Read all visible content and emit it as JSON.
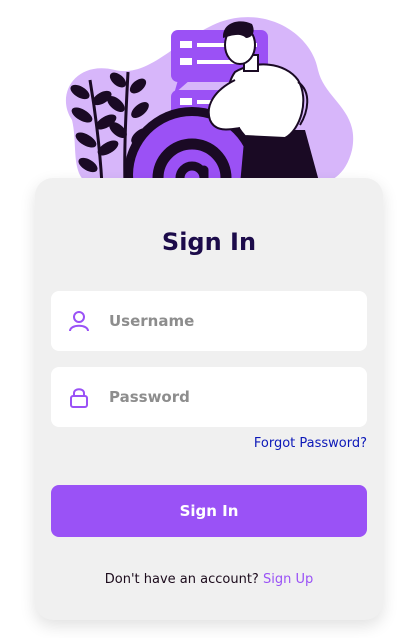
{
  "form": {
    "title": "Sign In",
    "username_placeholder": "Username",
    "password_placeholder": "Password",
    "forgot_label": "Forgot Password?",
    "submit_label": "Sign In",
    "signup_prompt": "Don't have an account?",
    "signup_label": "Sign Up"
  },
  "icons": {
    "username": "user-icon",
    "password": "lock-icon",
    "illustration": "email-at-illustration"
  },
  "colors": {
    "accent": "#9a52f6",
    "title": "#1c0b4a",
    "link": "#0c18b8",
    "card": "#f0f0f0"
  }
}
